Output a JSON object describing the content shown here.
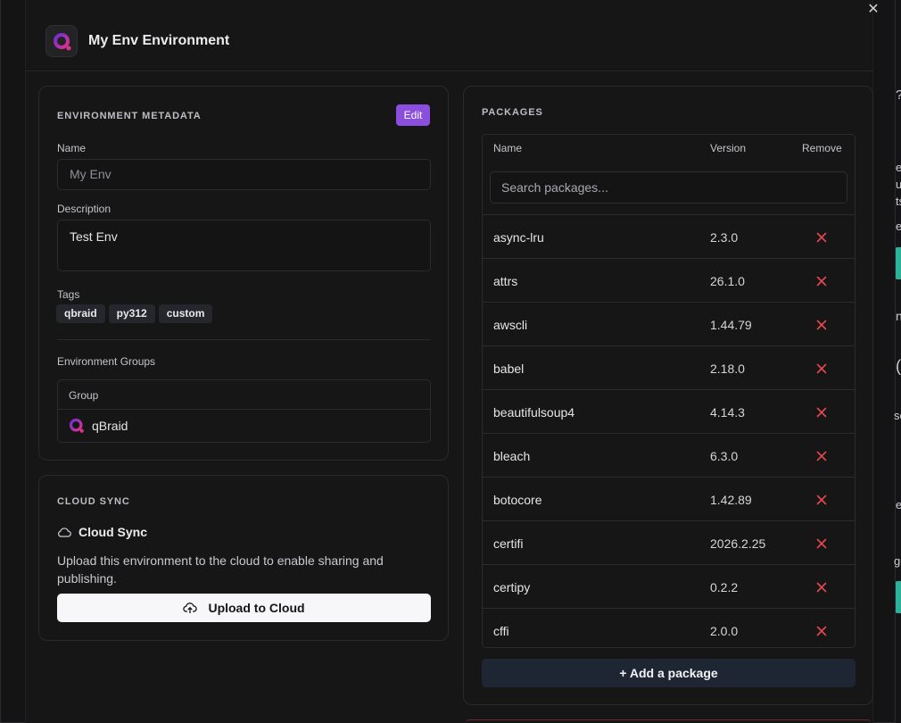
{
  "background": {
    "fragments": [
      "?",
      "er",
      "u",
      "ts",
      "e",
      "n",
      "(",
      "sc",
      "e",
      "ge"
    ]
  },
  "modal": {
    "title": "My Env Environment",
    "close_icon": "x-icon"
  },
  "metadata": {
    "section_label": "ENVIRONMENT METADATA",
    "edit_label": "Edit",
    "name_label": "Name",
    "name_value": "My Env",
    "description_label": "Description",
    "description_value": "Test Env",
    "tags_label": "Tags",
    "tags": [
      "qbraid",
      "py312",
      "custom"
    ],
    "groups_label": "Environment Groups",
    "group_column": "Group",
    "group_value": "qBraid"
  },
  "cloud_sync": {
    "section_label": "CLOUD SYNC",
    "title": "Cloud Sync",
    "description": "Upload this environment to the cloud to enable sharing and publishing.",
    "button_label": "Upload to Cloud"
  },
  "packages": {
    "section_label": "PACKAGES",
    "columns": {
      "name": "Name",
      "version": "Version",
      "remove": "Remove"
    },
    "search_placeholder": "Search packages...",
    "rows": [
      {
        "name": "async-lru",
        "version": "2.3.0"
      },
      {
        "name": "attrs",
        "version": "26.1.0"
      },
      {
        "name": "awscli",
        "version": "1.44.79"
      },
      {
        "name": "babel",
        "version": "2.18.0"
      },
      {
        "name": "beautifulsoup4",
        "version": "4.14.3"
      },
      {
        "name": "bleach",
        "version": "6.3.0"
      },
      {
        "name": "botocore",
        "version": "1.42.89"
      },
      {
        "name": "certifi",
        "version": "2026.2.25"
      },
      {
        "name": "certipy",
        "version": "0.2.2"
      },
      {
        "name": "cffi",
        "version": "2.0.0"
      }
    ],
    "add_label": "+ Add a package"
  },
  "colors": {
    "accent": "#8b4fe0",
    "remove": "#e5484d",
    "add_button": "#1f2633"
  }
}
